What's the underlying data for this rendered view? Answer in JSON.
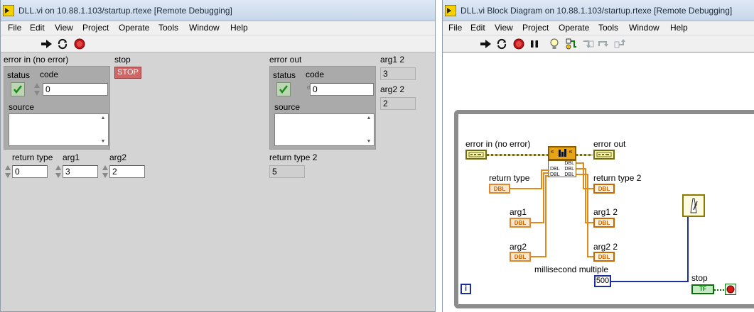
{
  "front_panel": {
    "title": "DLL.vi on 10.88.1.103/startup.rtexe [Remote Debugging]",
    "menu": [
      "File",
      "Edit",
      "View",
      "Project",
      "Operate",
      "Tools",
      "Window",
      "Help"
    ],
    "error_in": {
      "label": "error in (no error)",
      "status_label": "status",
      "code_label": "code",
      "code_value": "0",
      "source_label": "source"
    },
    "stop": {
      "label": "stop",
      "button_text": "STOP"
    },
    "error_out": {
      "label": "error out",
      "status_label": "status",
      "code_label": "code",
      "code_value": "0",
      "source_label": "source"
    },
    "arg1_2": {
      "label": "arg1 2",
      "value": "3"
    },
    "arg2_2": {
      "label": "arg2 2",
      "value": "2"
    },
    "return_type": {
      "label": "return type",
      "value": "0"
    },
    "arg1": {
      "label": "arg1",
      "value": "3"
    },
    "arg2": {
      "label": "arg2",
      "value": "2"
    },
    "return_type_2": {
      "label": "return type 2",
      "value": "5"
    }
  },
  "block_diagram": {
    "title": "DLL.vi Block Diagram on 10.88.1.103/startup.rtexe [Remote Debugging]",
    "menu": [
      "File",
      "Edit",
      "View",
      "Project",
      "Operate",
      "Tools",
      "Window",
      "Help"
    ],
    "labels": {
      "error_in": "error in (no error)",
      "error_out": "error out",
      "return_type": "return type",
      "return_type_2": "return type 2",
      "arg1": "arg1",
      "arg1_2": "arg1 2",
      "arg2": "arg2",
      "arg2_2": "arg2 2",
      "ms_multiple": "millisecond multiple",
      "stop": "stop"
    },
    "terminal_text": {
      "dbl": "DBL",
      "tf": "TF",
      "iteration": "i"
    },
    "constant_500": "500"
  },
  "colors": {
    "numeric_orange": "#cc6600",
    "error_cluster": "#6d6d12",
    "boolean_green": "#0a6e0a",
    "integer_blue": "#1f2f9c",
    "stop_red": "#d06666"
  }
}
